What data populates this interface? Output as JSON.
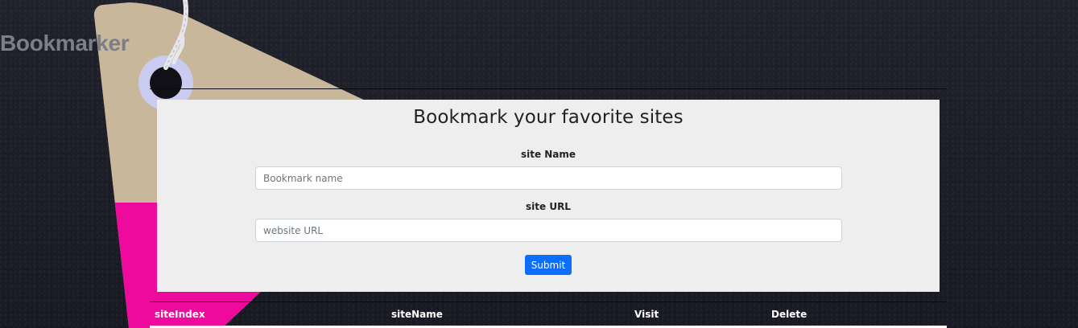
{
  "app": {
    "title": "Bookmarker"
  },
  "form": {
    "heading": "Bookmark your favorite sites",
    "site_name_label": "site Name",
    "site_name_placeholder": "Bookmark name",
    "site_name_value": "",
    "site_url_label": "site URL",
    "site_url_placeholder": "website URL",
    "site_url_value": "",
    "submit_label": "Submit"
  },
  "table": {
    "columns": [
      "siteIndex",
      "siteName",
      "Visit",
      "Delete"
    ],
    "rows": []
  },
  "colors": {
    "background": "#1c1d26",
    "card_background": "#eeeeee",
    "submit_button": "#0d6efd",
    "tag_paper": "#c8b79a",
    "tag_accent": "#ee0a9c",
    "tag_ring": "#c9ccf0"
  },
  "decoration": {
    "icon": "price-tag-icon"
  }
}
